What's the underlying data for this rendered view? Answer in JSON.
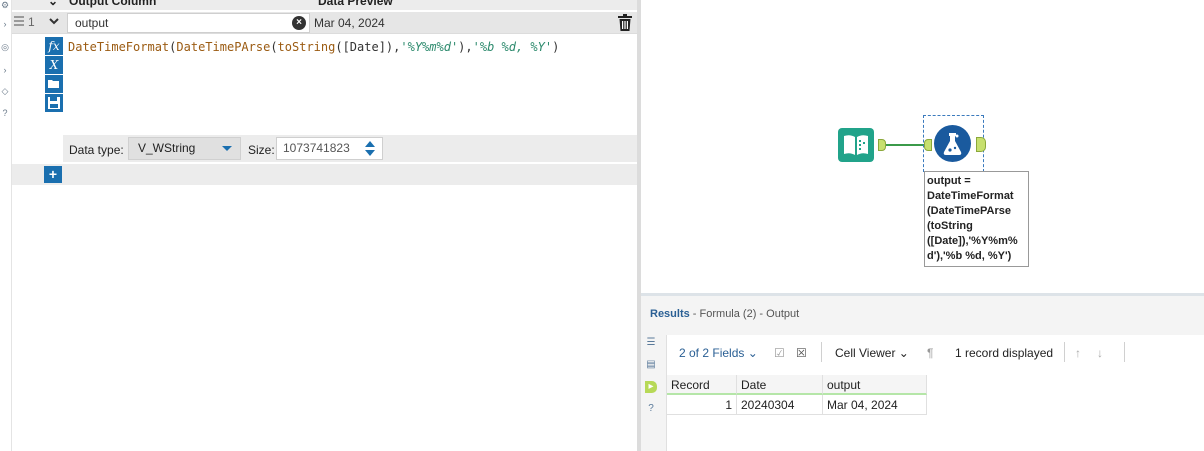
{
  "formula_panel": {
    "header": {
      "output_column": "Output Column",
      "data_preview": "Data Preview"
    },
    "row": {
      "number": "1",
      "output_name": "output",
      "preview": "Mar 04, 2024"
    },
    "expression": {
      "f1": "DateTimeFormat",
      "p1": "(",
      "f2": "DateTimePArse",
      "p2": "(",
      "f3": "toString",
      "p3": "([Date]),",
      "s1": "'%Y%m%d'",
      "p4": "),",
      "s2": "'%b %d, %Y'",
      "p5": ")"
    },
    "tools": {
      "fx": "fx",
      "x": "X"
    },
    "data_type_label": "Data type:",
    "data_type_value": "V_WString",
    "size_label": "Size:",
    "size_value": "1073741823",
    "add_label": "+"
  },
  "canvas": {
    "annotation": "output = DateTimeFormat (DateTimePArse (toString ([Date]),'%Y%m% d'),'%b %d, %Y')"
  },
  "results": {
    "title_bold": "Results",
    "title_rest": " - Formula (2) - Output",
    "fields": "2 of 2 Fields",
    "cell_viewer": "Cell Viewer",
    "records": "1 record displayed",
    "columns": [
      "Record",
      "Date",
      "output"
    ],
    "rows": [
      {
        "record": "1",
        "date": "20240304",
        "output": "Mar 04, 2024"
      }
    ]
  },
  "colors": {
    "accent_blue": "#1a6faf",
    "input_tool_green": "#21a38a",
    "connector_green": "#3b9a4a"
  },
  "icons": [
    "drag-handle-icon",
    "chevron-down-icon",
    "clear-icon",
    "trash-icon",
    "fx-icon",
    "variable-icon",
    "open-folder-icon",
    "save-icon",
    "add-icon",
    "input-data-icon",
    "formula-flask-icon",
    "list-icon",
    "checkbox-icon",
    "close-box-icon",
    "pilcrow-icon",
    "arrow-up-icon",
    "arrow-down-icon",
    "help-icon"
  ]
}
